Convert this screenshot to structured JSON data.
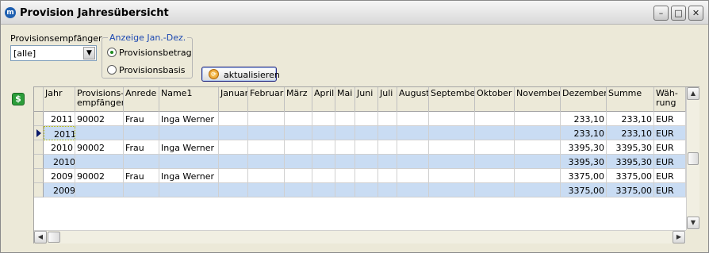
{
  "window": {
    "title": "Provision Jahresübersicht",
    "icon": "app-logo-icon"
  },
  "controls": {
    "recipient_label": "Provisionsempfänger",
    "recipient_value": "[alle]",
    "group_label": "Anzeige Jan.-Dez.",
    "radio_options": [
      {
        "label": "Provisionsbetrag",
        "selected": true
      },
      {
        "label": "Provisionsbasis",
        "selected": false
      }
    ],
    "refresh_label": "aktualisieren"
  },
  "table": {
    "columns": [
      "Jahr",
      "Provisions-\nempfänger",
      "Anrede",
      "Name1",
      "Januar",
      "Februar",
      "März",
      "April",
      "Mai",
      "Juni",
      "Juli",
      "August",
      "September",
      "Oktober",
      "November",
      "Dezember",
      "Summe",
      "Wäh-\nrung"
    ],
    "rows": [
      {
        "jahr": "2011",
        "empf": "90002",
        "anrede": "Frau",
        "name1": "Inga Werner",
        "dez": "233,10",
        "summe": "233,10",
        "waehrung": "EUR",
        "subtotal": false,
        "current": false
      },
      {
        "jahr": "2011",
        "empf": "",
        "anrede": "",
        "name1": "",
        "dez": "233,10",
        "summe": "233,10",
        "waehrung": "EUR",
        "subtotal": true,
        "current": true
      },
      {
        "jahr": "2010",
        "empf": "90002",
        "anrede": "Frau",
        "name1": "Inga Werner",
        "dez": "3395,30",
        "summe": "3395,30",
        "waehrung": "EUR",
        "subtotal": false,
        "current": false
      },
      {
        "jahr": "2010",
        "empf": "",
        "anrede": "",
        "name1": "",
        "dez": "3395,30",
        "summe": "3395,30",
        "waehrung": "EUR",
        "subtotal": true,
        "current": false
      },
      {
        "jahr": "2009",
        "empf": "90002",
        "anrede": "Frau",
        "name1": "Inga Werner",
        "dez": "3375,00",
        "summe": "3375,00",
        "waehrung": "EUR",
        "subtotal": false,
        "current": false
      },
      {
        "jahr": "2009",
        "empf": "",
        "anrede": "",
        "name1": "",
        "dez": "3375,00",
        "summe": "3375,00",
        "waehrung": "EUR",
        "subtotal": true,
        "current": false
      }
    ]
  },
  "colors": {
    "subtotal_row": "#c9dcf3",
    "accent": "#1c48b2"
  }
}
